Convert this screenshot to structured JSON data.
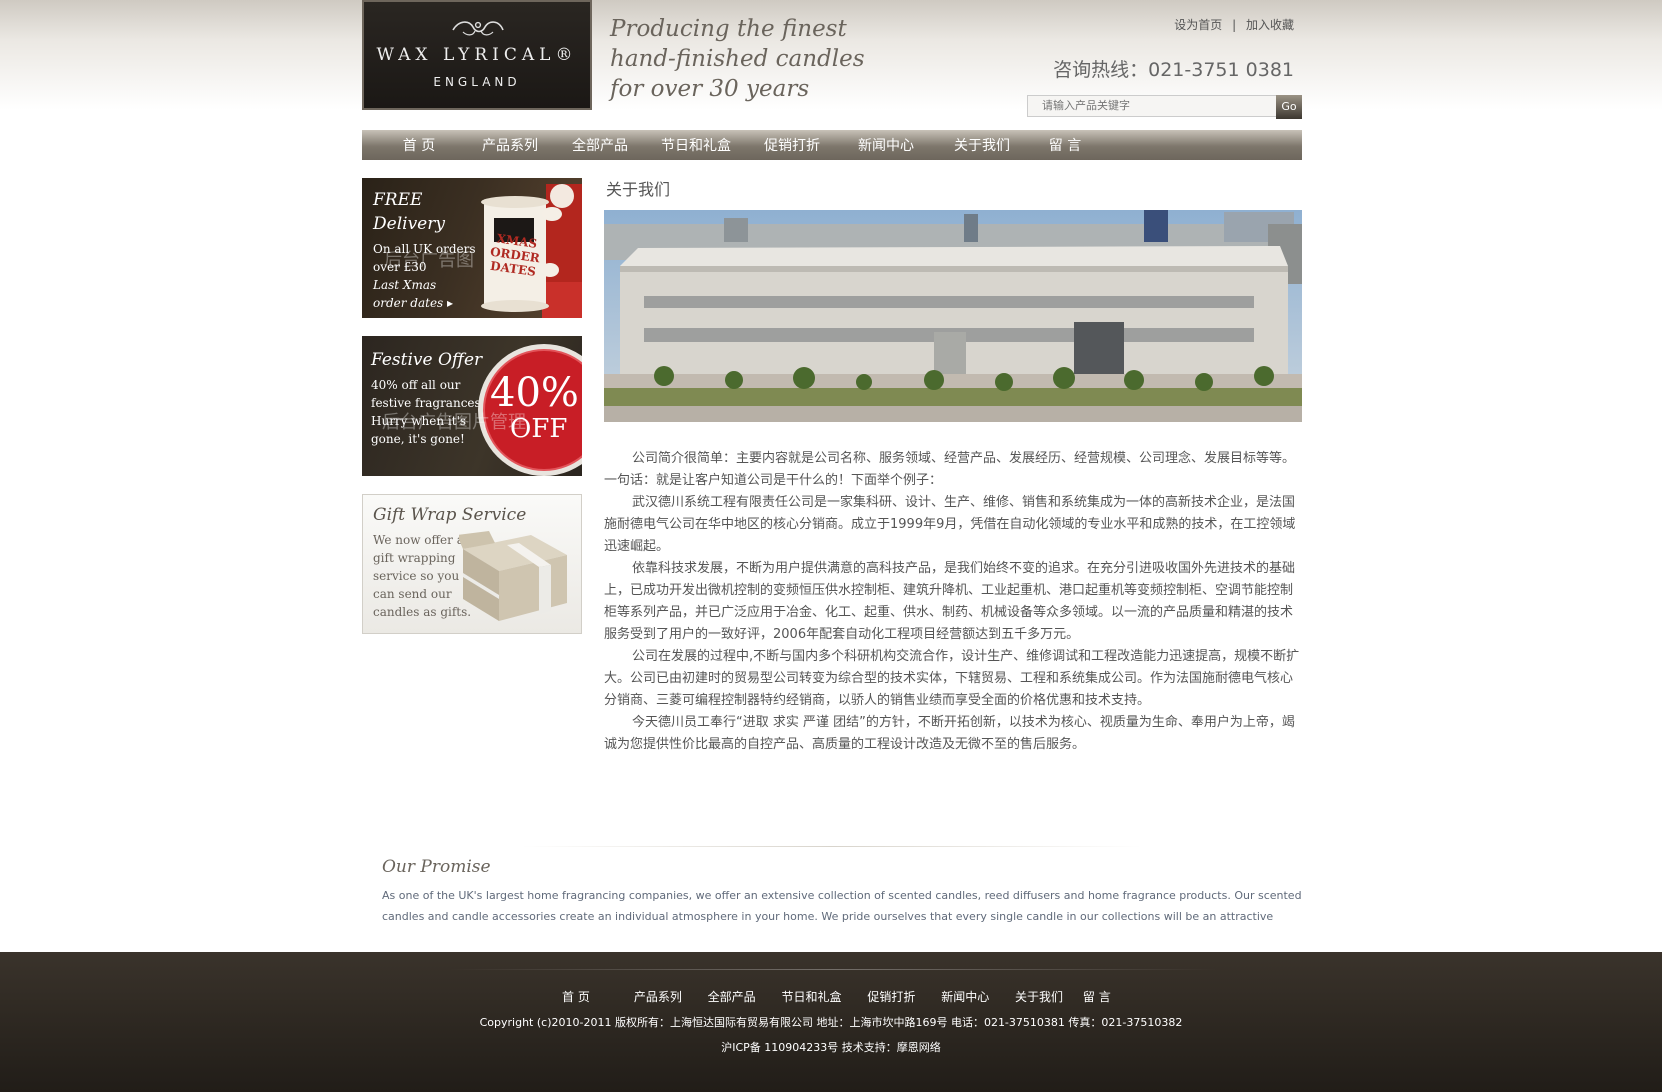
{
  "header": {
    "logo_brand": "WAX LYRICAL®",
    "logo_sub": "ENGLAND",
    "tagline_lines": [
      "Producing the finest",
      "hand-finished candles",
      "for over 30 years"
    ],
    "set_home": "设为首页",
    "separator": "|",
    "add_favorite": "加入收藏",
    "hotline": "咨询热线：021-3751 0381",
    "search_placeholder": "请输入产品关键字",
    "search_button": "Go"
  },
  "nav": {
    "items": [
      "首 页",
      "产品系列",
      "全部产品",
      "节日和礼盒",
      "促销打折",
      "新闻中心",
      "关于我们",
      "留 言"
    ]
  },
  "sidebar": {
    "banners": [
      {
        "title_lines": [
          "FREE",
          "Delivery"
        ],
        "text_lines": [
          "On all UK orders",
          "over £30"
        ],
        "italic_lines": [
          "Last Xmas",
          "order dates ▸"
        ],
        "badge_lines": [
          "XMAS",
          "ORDER",
          "DATES"
        ],
        "watermark": "后台广告图"
      },
      {
        "title": "Festive Offer",
        "text_lines": [
          "40% off all our",
          "festive fragrances",
          "Hurry when it's",
          "gone, it's gone!"
        ],
        "badge_big": "40%",
        "badge_small": "OFF",
        "watermark": "后台广告图片管理"
      },
      {
        "title": "Gift Wrap Service",
        "text_lines": [
          "We now offer a",
          "gift wrapping",
          "service so you",
          "can send our",
          "candles as gifts."
        ]
      }
    ]
  },
  "main": {
    "title": "关于我们",
    "paragraphs": [
      "公司简介很简单：主要内容就是公司名称、服务领域、经营产品、发展经历、经营规模、公司理念、发展目标等等。一句话：就是让客户知道公司是干什么的！下面举个例子：",
      "武汉德川系统工程有限责任公司是一家集科研、设计、生产、维修、销售和系统集成为一体的高新技术企业，是法国施耐德电气公司在华中地区的核心分销商。成立于1999年9月，凭借在自动化领域的专业水平和成熟的技术，在工控领域迅速崛起。",
      "依靠科技求发展，不断为用户提供满意的高科技产品，是我们始终不变的追求。在充分引进吸收国外先进技术的基础上，已成功开发出微机控制的变频恒压供水控制柜、建筑升降机、工业起重机、港口起重机等变频控制柜、空调节能控制柜等系列产品，并已广泛应用于冶金、化工、起重、供水、制药、机械设备等众多领域。以一流的产品质量和精湛的技术服务受到了用户的一致好评，2006年配套自动化工程项目经营额达到五千多万元。",
      "公司在发展的过程中,不断与国内多个科研机构交流合作，设计生产、维修调试和工程改造能力迅速提高，规模不断扩大。公司已由初建时的贸易型公司转变为综合型的技术实体，下辖贸易、工程和系统集成公司。作为法国施耐德电气核心分销商、三菱可编程控制器特约经销商，以骄人的销售业绩而享受全面的价格优惠和技术支持。",
      "今天德川员工奉行“进取 求实 严谨 团结”的方针，不断开拓创新，以技术为核心、视质量为生命、奉用户为上帝，竭诚为您提供性价比最高的自控产品、高质量的工程设计改造及无微不至的售后服务。"
    ]
  },
  "promise": {
    "title": "Our Promise",
    "lines": [
      "As one of the UK's largest home fragrancing companies, we offer an extensive collection of scented candles, reed diffusers and home fragrance products. Our scented",
      "candles and candle accessories create an individual atmosphere in your home. We pride ourselves that every single candle in our collections will be an attractive"
    ]
  },
  "footer": {
    "nav": [
      "首 页",
      "产品系列",
      "全部产品",
      "节日和礼盒",
      "促销打折",
      "新闻中心",
      "关于我们",
      "留 言"
    ],
    "copyright": "Copyright (c)2010-2011 版权所有：上海恒达国际有贸易有限公司 地址：上海市坎中路169号 电话：021-37510381 传真：021-37510382",
    "icp": "沪ICP备 110904233号  技术支持：摩恩网络"
  }
}
